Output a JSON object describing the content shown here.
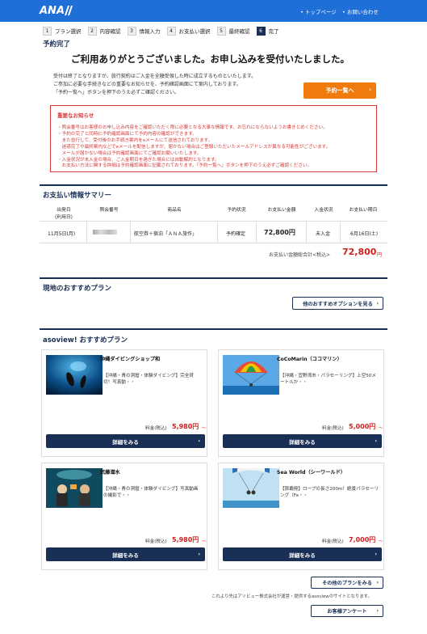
{
  "header": {
    "logo": "ANA",
    "links": [
      "• トップページ",
      "• お問い合わせ"
    ]
  },
  "steps": [
    {
      "num": "1",
      "label": "プラン選択"
    },
    {
      "num": "2",
      "label": "内容確認"
    },
    {
      "num": "3",
      "label": "情報入力"
    },
    {
      "num": "4",
      "label": "お支払い選択"
    },
    {
      "num": "5",
      "label": "最終確認"
    },
    {
      "num": "6",
      "label": "完了"
    }
  ],
  "complete": {
    "title": "予約完了",
    "headline": "ご利用ありがとうございました。お申し込みを受付いたしました。",
    "intro": [
      "受付は終了となりますが、旅行契約はご入金を全額受領した時に成立するものといたします。",
      "ご参加に必要な手続きなどの重要なお知らせを、予約確認画面にて案内しております。",
      "「予約一覧へ」ボタンを押下のうえ必ずご確認ください。"
    ],
    "reservation_list_button": "予約一覧へ"
  },
  "notice": {
    "title": "重要なお知らせ",
    "lines": [
      "・照会番号はお客様のお申し込み内容をご確認いただく際に必要となる大事な情報です。お忘れにならないようお書きとめください。",
      "・予約の完了と同時に予約確認画面にて予約内容の確認ができます。",
      "　また並行して、受付後のお手続き案内をeメールにて送信されております。",
      "　迷惑完了や最終案内などでeメールを配信しますが、届かない場合はご登録いただいたメールアドレスが異なる可能性がございます。",
      "　メールが届かない場合は予約確認画面にてご確認お願いいたします。",
      "・入金状況が未入金の場合、ご入金期日を過ぎた場合には自動解約となります。",
      "　お支払い方法に関する詳細は予約確認画面に記載されております。「予約一覧へ」ボタンを押下のうえ必ずご確認ください。"
    ]
  },
  "payment_summary": {
    "title": "お支払い情報サマリー",
    "columns": [
      "出発日\n(利用日)",
      "照会番号",
      "商品名",
      "予約状況",
      "お支払い金額",
      "入金状況",
      "お支払い期日"
    ],
    "row": {
      "date": "11月5日(月)",
      "product": "航空券＋宿泊「ＡＮＡ旅作」",
      "status": "予約確定",
      "amount": "72,800円",
      "payment_status": "未入金",
      "due": "6月16日(土)"
    },
    "total_label": "お支払い金額総合計<税込>",
    "total_value": "72,800",
    "total_unit": "円"
  },
  "local_plans": {
    "title": "現地のおすすめプラン",
    "button": "他のおすすめオプションを見る"
  },
  "asoview": {
    "title": "asoview! おすすめプラン",
    "price_label": "料金(税込)",
    "price_suffix": "〜",
    "detail_button": "詳細をみる",
    "cards": [
      {
        "name": "沖縄ダイビングショップ和",
        "desc": "【沖縄・青の洞窟・体験ダイビング】完全貸切！写真動・・",
        "price": "5,980円"
      },
      {
        "name": "CoCoMarin（ココマリン）",
        "desc": "【沖縄・宜野湾市・パラセーリング】上空50メートルか・・",
        "price": "5,000円"
      },
      {
        "name": "武藤潜水",
        "desc": "【沖縄・青の洞窟・体験ダイビング】写真動画の撮影で・・",
        "price": "5,980円"
      },
      {
        "name": "Sea World（シーワールド）",
        "desc": "【那覇発】ロープの長さ200m！絶景パラセーリング（Fa・・",
        "price": "7,000円"
      }
    ],
    "more_plans_button": "その他のプランをみる",
    "disclaimer": "これより先はアソビュー株式会社が運営・提供するasoviewのサイトとなります。",
    "survey_button": "お客様アンケート"
  }
}
